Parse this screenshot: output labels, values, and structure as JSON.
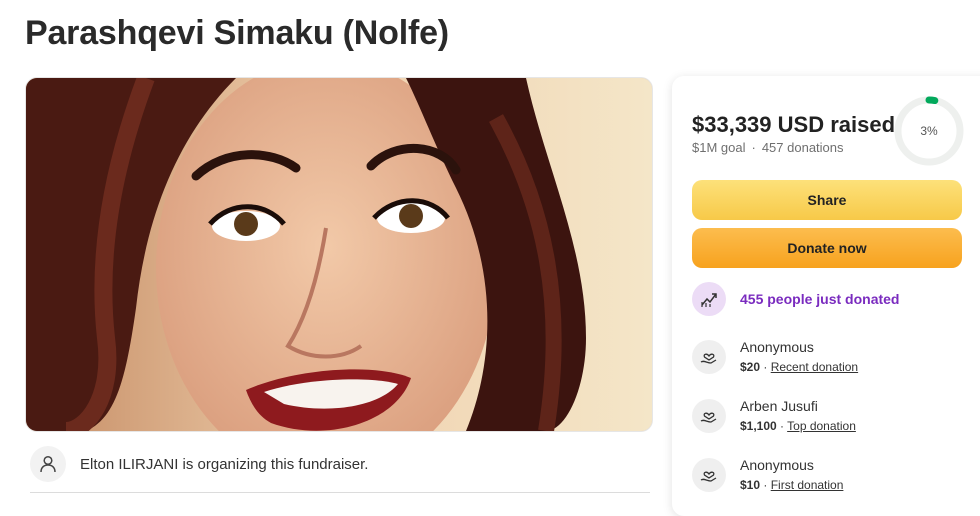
{
  "page": {
    "title": "Parashqevi Simaku (Nolfe)"
  },
  "organizer": {
    "text": "Elton ILIRJANI is organizing this fundraiser."
  },
  "progress": {
    "raised": "$33,339 USD raised",
    "goal": "$1M goal",
    "donations": "457 donations",
    "percent_label": "3%",
    "percent_value": 3
  },
  "buttons": {
    "share": "Share",
    "donate": "Donate now"
  },
  "trending": {
    "text": "455 people just donated"
  },
  "donations": [
    {
      "name": "Anonymous",
      "amount": "$20",
      "tag": "Recent donation"
    },
    {
      "name": "Arben Jusufi",
      "amount": "$1,100",
      "tag": "Top donation"
    },
    {
      "name": "Anonymous",
      "amount": "$10",
      "tag": "First donation"
    }
  ],
  "colors": {
    "accent_green": "#02a95c",
    "trend_purple": "#7a2bbf",
    "share_yellow": "#f7c948",
    "donate_orange": "#f7a21e"
  },
  "icons": {
    "organizer": "person-icon",
    "trending": "trending-up-icon",
    "donation": "heart-hand-icon"
  }
}
